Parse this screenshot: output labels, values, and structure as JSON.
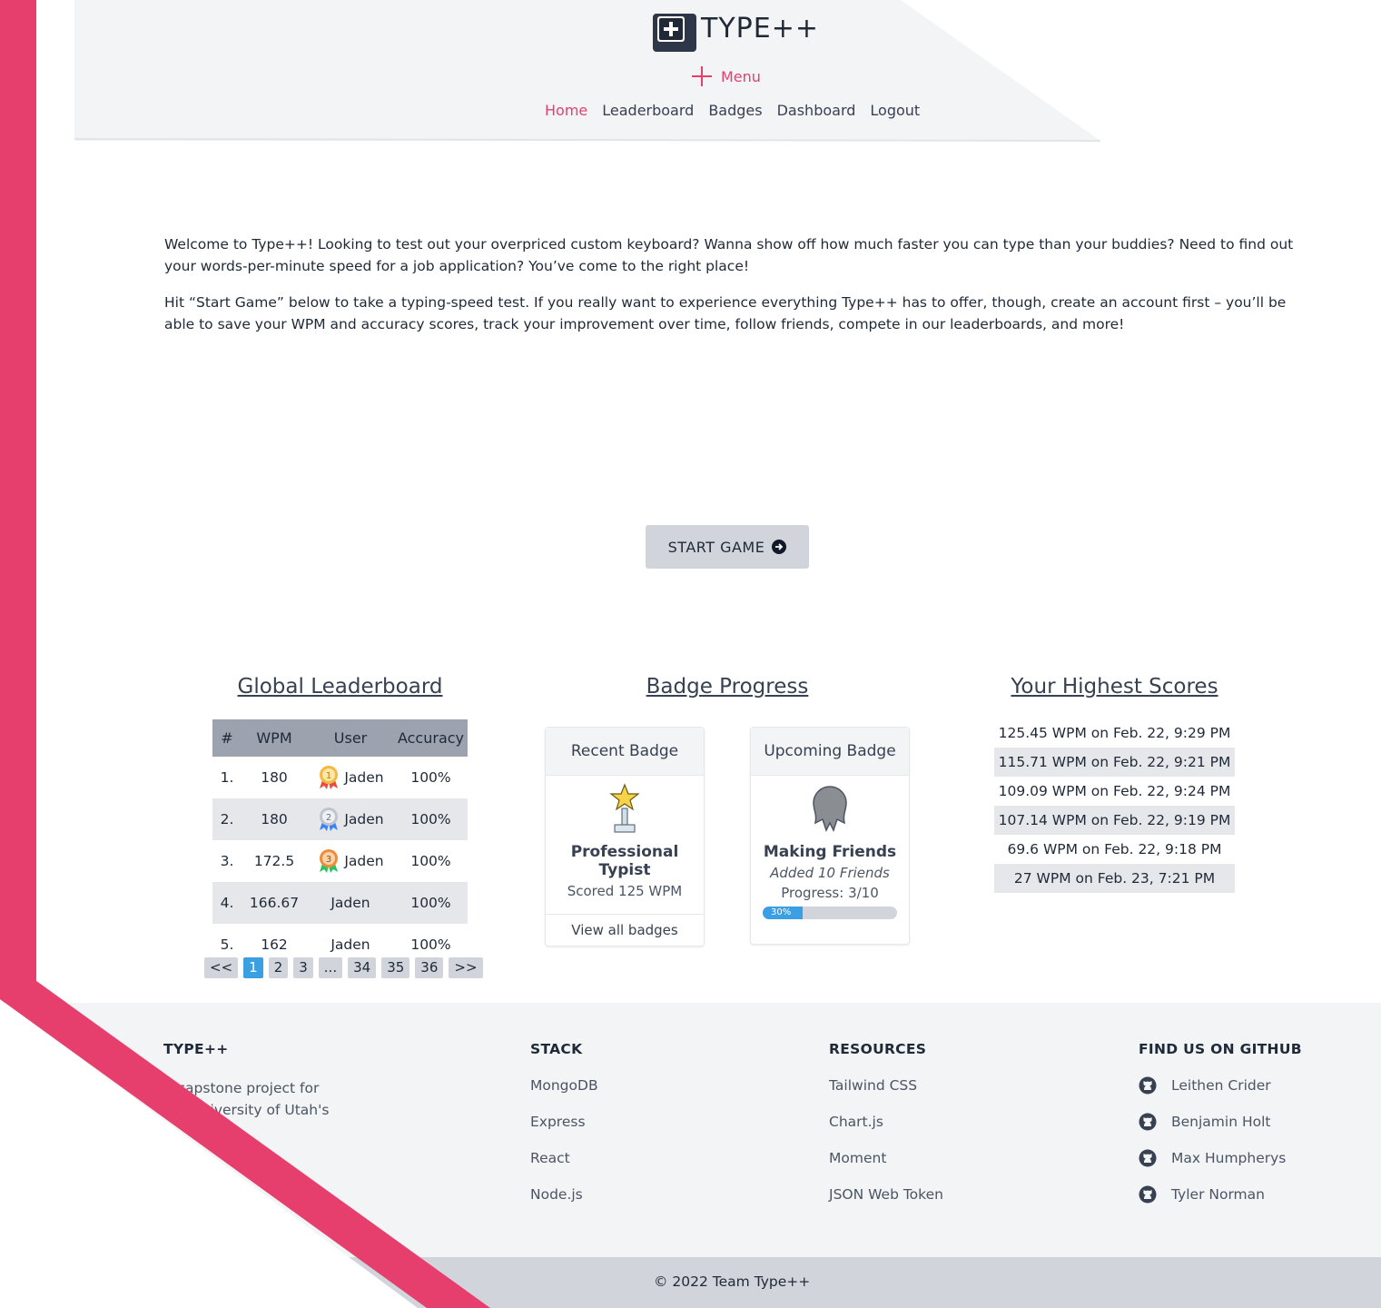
{
  "brand": {
    "name": "TYPE++"
  },
  "header": {
    "menu_label": "Menu",
    "nav": [
      {
        "label": "Home",
        "active": true
      },
      {
        "label": "Leaderboard"
      },
      {
        "label": "Badges"
      },
      {
        "label": "Dashboard"
      },
      {
        "label": "Logout"
      }
    ]
  },
  "intro": {
    "p1": "Welcome to Type++! Looking to test out your overpriced custom keyboard? Wanna show off how much faster you can type than your buddies? Need to find out your words-per-minute speed for a job application? You’ve come to the right place!",
    "p2": "Hit “Start Game” below to take a typing-speed test. If you really want to experience everything Type++ has to offer, though, create an account first – you’ll be able to save your WPM and accuracy scores, track your improvement over time, follow friends, compete in our leaderboards, and more!"
  },
  "start_button": {
    "label": "START GAME"
  },
  "leaderboard": {
    "title": "Global Leaderboard",
    "columns": [
      "#",
      "WPM",
      "User",
      "Accuracy"
    ],
    "rows": [
      {
        "rank": "1.",
        "wpm": "180",
        "user": "Jaden",
        "accuracy": "100%",
        "medal": "gold-medal-icon"
      },
      {
        "rank": "2.",
        "wpm": "180",
        "user": "Jaden",
        "accuracy": "100%",
        "medal": "silver-medal-icon"
      },
      {
        "rank": "3.",
        "wpm": "172.5",
        "user": "Jaden",
        "accuracy": "100%",
        "medal": "bronze-medal-icon"
      },
      {
        "rank": "4.",
        "wpm": "166.67",
        "user": "Jaden",
        "accuracy": "100%"
      },
      {
        "rank": "5.",
        "wpm": "162",
        "user": "Jaden",
        "accuracy": "100%"
      }
    ],
    "pagination": [
      "<<",
      "1",
      "2",
      "3",
      "...",
      "34",
      "35",
      "36",
      ">>"
    ],
    "current_page": "1"
  },
  "badges": {
    "title": "Badge Progress",
    "recent": {
      "header": "Recent Badge",
      "name": "Professional Typist",
      "description": "Scored 125 WPM",
      "footer": "View all badges"
    },
    "upcoming": {
      "header": "Upcoming Badge",
      "name": "Making Friends",
      "description": "Added 10 Friends",
      "progress_text": "Progress: 3/10",
      "progress_percent": 30,
      "progress_label": "30%"
    }
  },
  "scores": {
    "title": "Your Highest Scores",
    "items": [
      "125.45 WPM on Feb. 22, 9:29 PM",
      "115.71 WPM on Feb. 22, 9:21 PM",
      "109.09 WPM on Feb. 22, 9:24 PM",
      "107.14 WPM on Feb. 22, 9:19 PM",
      "69.6 WPM on Feb. 22, 9:18 PM",
      "27 WPM on Feb. 23, 7:21 PM"
    ]
  },
  "footer": {
    "about_heading": "TYPE++",
    "about_text_1": "A capstone project for the University of Utah's",
    "stack": {
      "heading": "STACK",
      "items": [
        "MongoDB",
        "Express",
        "React",
        "Node.js"
      ]
    },
    "resources": {
      "heading": "RESOURCES",
      "items": [
        "Tailwind CSS",
        "Chart.js",
        "Moment",
        "JSON Web Token"
      ]
    },
    "github": {
      "heading": "FIND US ON GITHUB",
      "items": [
        "Leithen Crider",
        "Benjamin Holt",
        "Max Humpherys",
        "Tyler Norman"
      ]
    },
    "copyright": "© 2022 Team Type++"
  },
  "colors": {
    "accent": "#e63e6d",
    "progress": "#3b9fe3",
    "header_bg": "#f3f4f6",
    "table_head": "#9ca3af"
  }
}
